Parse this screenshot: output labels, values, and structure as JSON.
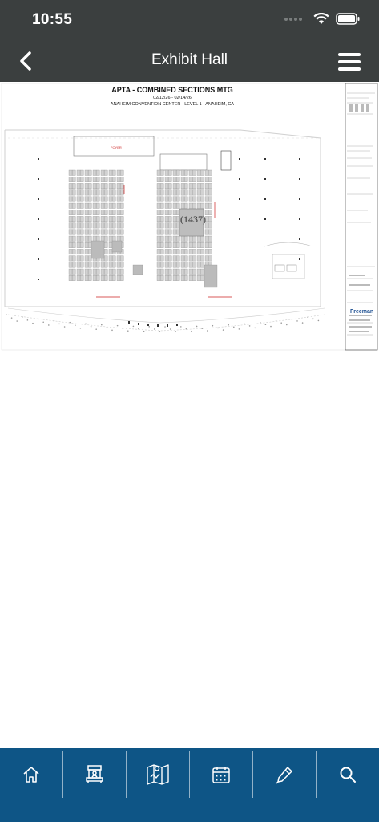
{
  "status_bar": {
    "time": "10:55"
  },
  "header": {
    "title": "Exhibit Hall"
  },
  "floor_plan": {
    "title": "APTA - COMBINED SECTIONS MTG",
    "dates": "02/12/26 - 02/14/26",
    "venue": "ANAHEIM CONVENTION CENTER - LEVEL 1 - ANAHEIM, CA",
    "highlighted_booth": "(1437)",
    "brand": "Freeman"
  },
  "tabbar": {
    "tabs": [
      {
        "icon": "home-icon"
      },
      {
        "icon": "booth-icon"
      },
      {
        "icon": "map-icon"
      },
      {
        "icon": "calendar-icon"
      },
      {
        "icon": "pen-icon"
      },
      {
        "icon": "search-icon"
      }
    ]
  },
  "colors": {
    "header_bg": "#3b3f3f",
    "tabbar_bg": "#0e5586",
    "highlight": "#cc2222"
  }
}
